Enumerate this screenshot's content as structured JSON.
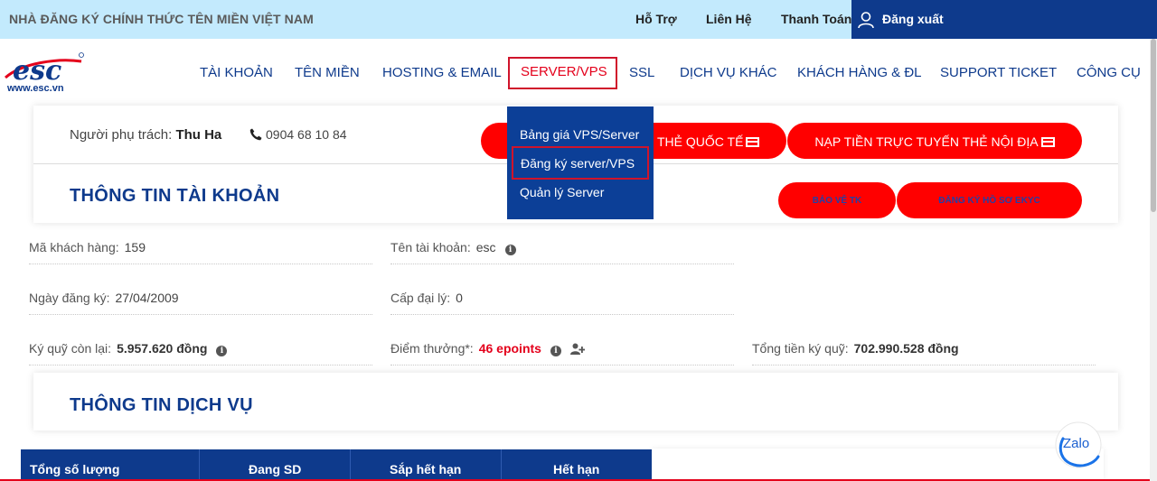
{
  "topbar": {
    "brand": "NHÀ ĐĂNG KÝ CHÍNH THỨC TÊN MIỀN VIỆT NAM",
    "links": [
      "Hỗ Trợ",
      "Liên Hệ",
      "Thanh Toán"
    ],
    "logout": "Đăng xuất"
  },
  "logo": {
    "text": "esc",
    "url_text": "www.esc.vn"
  },
  "nav": {
    "items": [
      "TÀI KHOẢN",
      "TÊN MIỀN",
      "HOSTING & EMAIL",
      "SERVER/VPS",
      "SSL",
      "DỊCH VỤ KHÁC",
      "KHÁCH HÀNG & ĐL",
      "SUPPORT TICKET",
      "CÔNG CỤ"
    ],
    "active": "SERVER/VPS"
  },
  "dropdown": {
    "items": [
      "Bảng giá VPS/Server",
      "Đăng ký server/VPS",
      "Quản lý Server"
    ]
  },
  "account_card": {
    "resp_label": "Người phụ trách:",
    "resp_name": "Thu Ha",
    "phone": "0904 68 10 84",
    "btn_intl": "THẺ QUỐC TẾ",
    "btn_domestic": "NẠP TIỀN TRỰC TUYẾN THẺ NỘI ĐỊA",
    "title": "THÔNG TIN TÀI KHOẢN",
    "btn_protect": "BẢO VỆ TK",
    "btn_ekyc": "ĐĂNG KÝ HỒ SƠ EKYC"
  },
  "info": {
    "customer_code_label": "Mã khách hàng:",
    "customer_code": "159",
    "account_name_label": "Tên tài khoản:",
    "account_name": "esc",
    "reg_date_label": "Ngày đăng ký:",
    "reg_date": "27/04/2009",
    "agent_level_label": "Cấp đại lý:",
    "agent_level": "0",
    "deposit_left_label": "Ký quỹ còn lại:",
    "deposit_left": "5.957.620 đồng",
    "points_label": "Điểm thưởng*:",
    "points": "46 epoints",
    "total_deposit_label": "Tổng tiền ký quỹ:",
    "total_deposit": "702.990.528 đồng"
  },
  "service_card": {
    "title": "THÔNG TIN DỊCH VỤ"
  },
  "table": {
    "headers": [
      "Tổng số lượng",
      "Đang SD",
      "Sắp hết hạn",
      "Hết hạn"
    ]
  },
  "zalo": {
    "label": "Zalo"
  },
  "colors": {
    "navy": "#0e3a8c",
    "red": "#ff0000",
    "topbar": "#c3eafd"
  }
}
